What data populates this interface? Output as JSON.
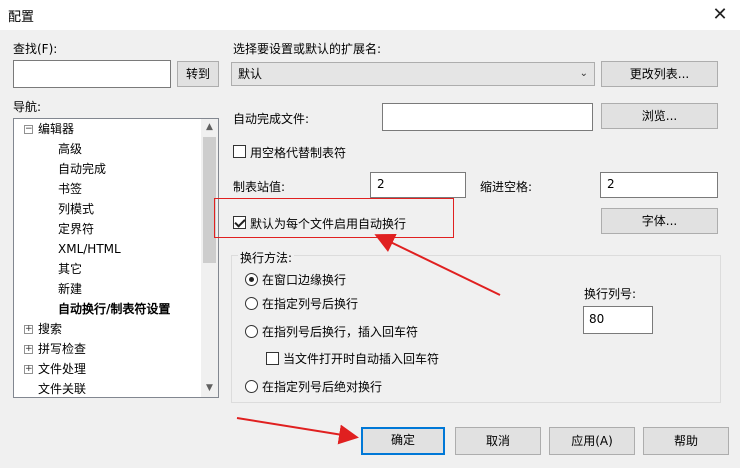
{
  "window": {
    "title": "配置",
    "close_glyph": "✕"
  },
  "find": {
    "label": "查找(F):",
    "value": "",
    "goto_label": "转到"
  },
  "nav": {
    "label": "导航:",
    "tree": [
      {
        "label": "编辑器",
        "toggle": "⊟",
        "level": 0
      },
      {
        "label": "高级",
        "level": 1
      },
      {
        "label": "自动完成",
        "level": 1
      },
      {
        "label": "书签",
        "level": 1
      },
      {
        "label": "列模式",
        "level": 1
      },
      {
        "label": "定界符",
        "level": 1
      },
      {
        "label": "XML/HTML",
        "level": 1
      },
      {
        "label": "其它",
        "level": 1
      },
      {
        "label": "新建",
        "level": 1
      },
      {
        "label": "自动换行/制表符设置",
        "level": 1,
        "selected": true
      },
      {
        "label": "搜索",
        "toggle": "⊞",
        "level": 0
      },
      {
        "label": "拼写检查",
        "toggle": "⊞",
        "level": 0
      },
      {
        "label": "文件处理",
        "toggle": "⊞",
        "level": 0
      },
      {
        "label": "文件关联",
        "level": 0
      }
    ]
  },
  "settings": {
    "ext_label": "选择要设置或默认的扩展名:",
    "ext_value": "默认",
    "change_list_label": "更改列表...",
    "autocomplete_label": "自动完成文件:",
    "autocomplete_value": "",
    "browse_label": "浏览...",
    "use_spaces_label": "用空格代替制表符",
    "use_spaces_checked": false,
    "tab_stop_label": "制表站值:",
    "tab_stop_value": "2",
    "indent_label": "缩进空格:",
    "indent_value": "2",
    "wrap_default_label": "默认为每个文件启用自动换行",
    "wrap_default_checked": true,
    "font_label": "字体...",
    "wrap_method_label": "换行方法:",
    "wrap_options": [
      "在窗口边缘换行",
      "在指定列号后换行",
      "在指列号后换行，插入回车符",
      "在指定列号后绝对换行"
    ],
    "wrap_selected_index": 0,
    "insert_cr_label": "当文件打开时自动插入回车符",
    "insert_cr_checked": false,
    "wrap_column_label": "换行列号:",
    "wrap_column_value": "80"
  },
  "footer": {
    "ok_label": "确定",
    "cancel_label": "取消",
    "apply_label": "应用(A)",
    "help_label": "帮助"
  },
  "colors": {
    "annotation_red": "#e02020",
    "accent": "#0078d7"
  }
}
